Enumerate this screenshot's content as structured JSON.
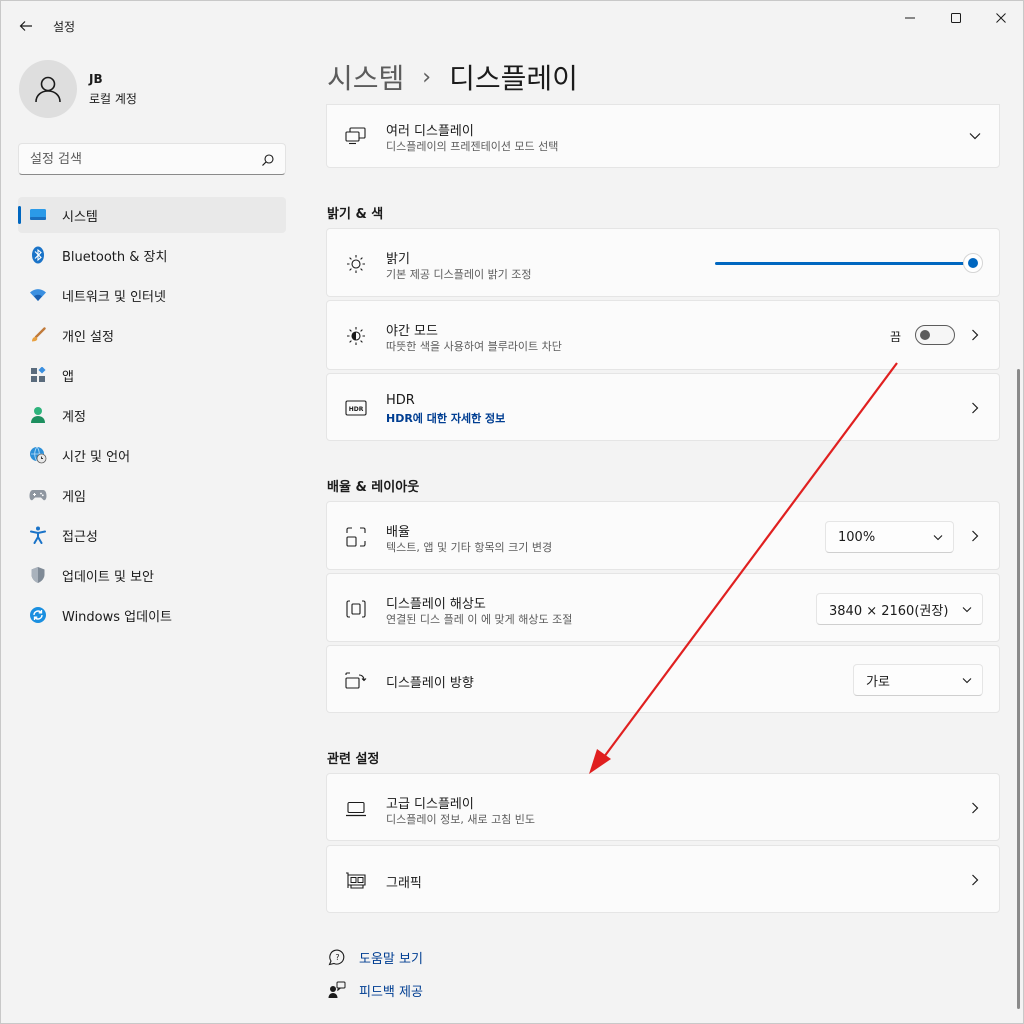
{
  "window": {
    "title": "설정"
  },
  "profile": {
    "name": "JB",
    "account": "로컬 계정"
  },
  "search": {
    "placeholder": "설정 검색"
  },
  "nav": [
    {
      "label": "시스템"
    },
    {
      "label": "Bluetooth & 장치"
    },
    {
      "label": "네트워크 및 인터넷"
    },
    {
      "label": "개인 설정"
    },
    {
      "label": "앱"
    },
    {
      "label": "계정"
    },
    {
      "label": "시간 및 언어"
    },
    {
      "label": "게임"
    },
    {
      "label": "접근성"
    },
    {
      "label": "업데이트 및 보안"
    },
    {
      "label": "Windows 업데이트"
    }
  ],
  "breadcrumb": {
    "parent": "시스템",
    "separator": "›",
    "current": "디스플레이"
  },
  "multi_display": {
    "title": "여러 디스플레이",
    "subtitle": "디스플레이의 프레젠테이션 모드 선택"
  },
  "sections": {
    "brightness_color": "밝기 & 색",
    "scale_layout": "배율 & 레이아웃",
    "related": "관련 설정"
  },
  "brightness": {
    "title": "밝기",
    "subtitle": "기본 제공 디스플레이 밝기 조정",
    "value_percent": 100
  },
  "night_light": {
    "title": "야간 모드",
    "subtitle": "따뜻한 색을 사용하여 블루라이트 차단",
    "state": "끔"
  },
  "hdr": {
    "title": "HDR",
    "link": "HDR에 대한 자세한 정보"
  },
  "scale": {
    "title": "배율",
    "subtitle": "텍스트, 앱 및 기타 항목의 크기 변경",
    "value": "100%"
  },
  "resolution": {
    "title": "디스플레이 해상도",
    "subtitle": "연결된 디스 플레 이 에 맞게 해상도 조절",
    "value": "3840 × 2160(권장)"
  },
  "orientation": {
    "title": "디스플레이 방향",
    "value": "가로"
  },
  "advanced": {
    "title": "고급 디스플레이",
    "subtitle": "디스플레이 정보, 새로 고침 빈도"
  },
  "graphics": {
    "title": "그래픽"
  },
  "footer": {
    "help": "도움말 보기",
    "feedback": "피드백 제공"
  },
  "colors": {
    "accent": "#0067c0",
    "link": "#003e92",
    "annotation": "#e02020"
  }
}
